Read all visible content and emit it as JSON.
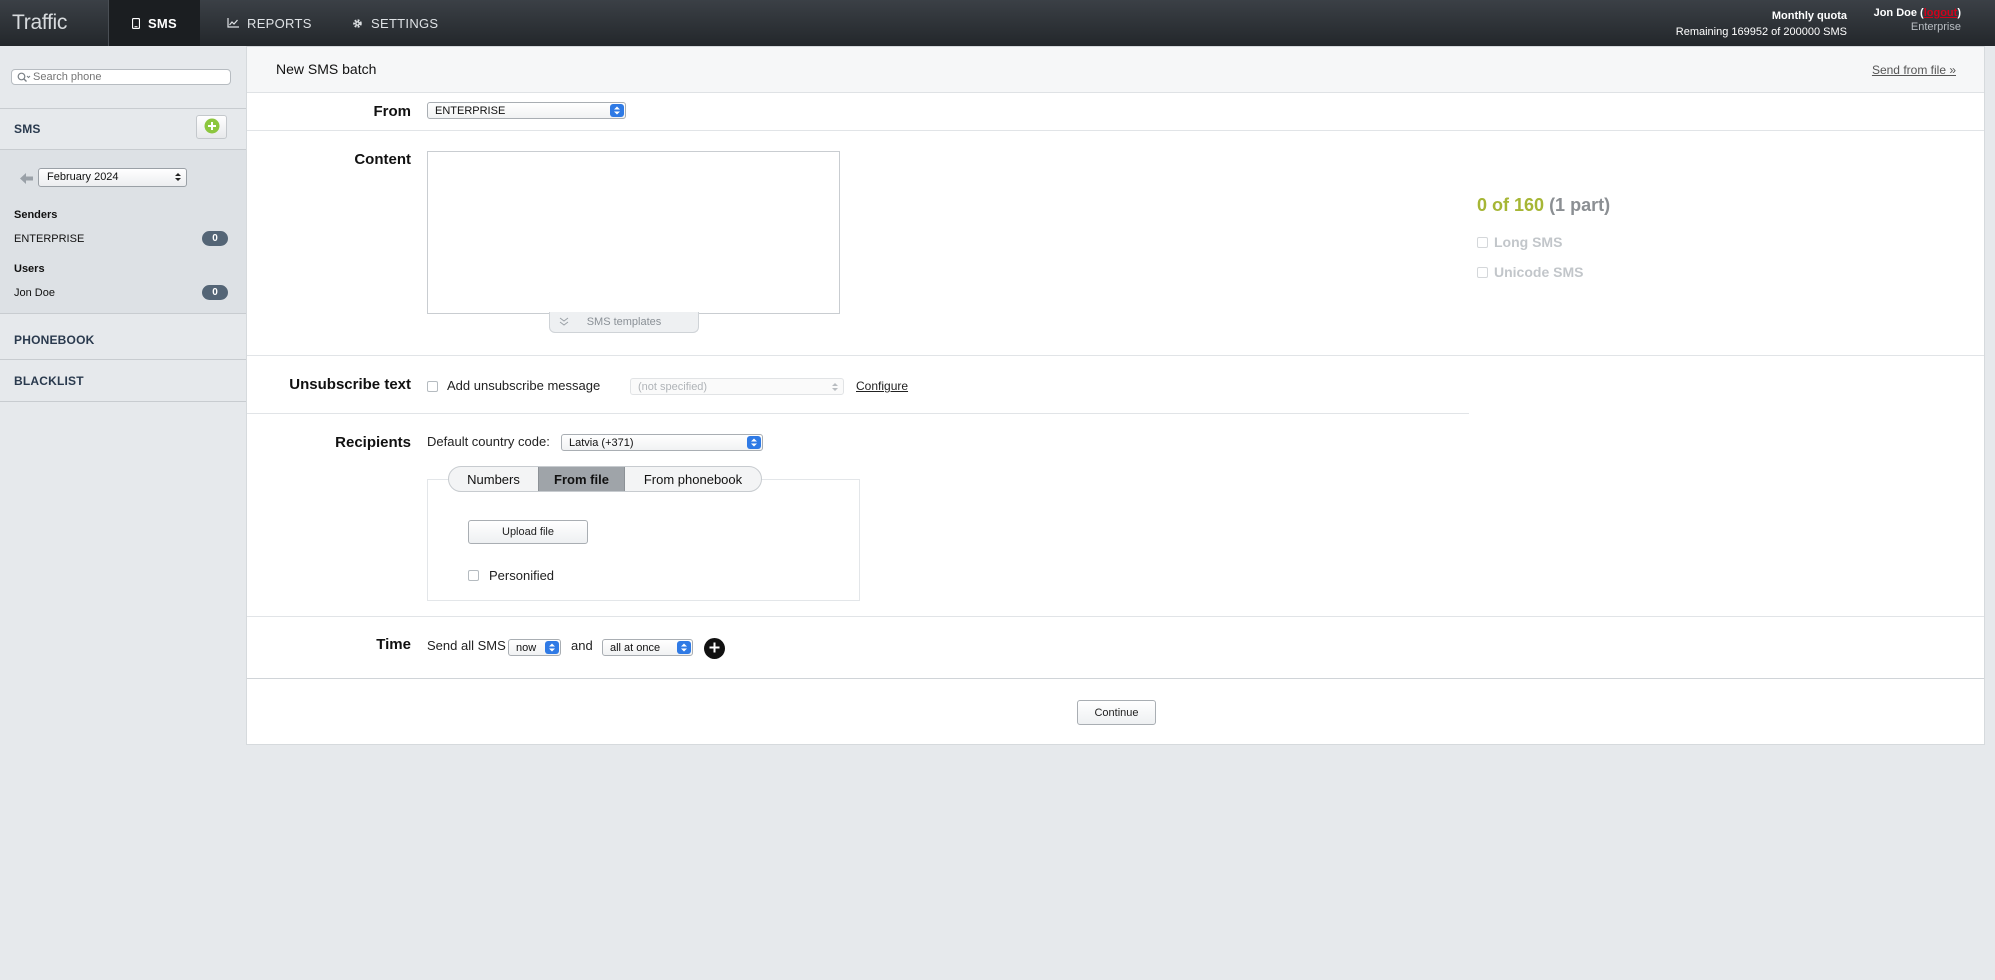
{
  "topbar": {
    "brand": "Traffic",
    "nav": [
      {
        "label": "SMS",
        "icon": "phone-icon"
      },
      {
        "label": "REPORTS",
        "icon": "chart-icon"
      },
      {
        "label": "SETTINGS",
        "icon": "gear-icon"
      }
    ],
    "quota_title": "Monthly quota",
    "quota_remaining": "Remaining 169952 of 200000 SMS",
    "user_name": "Jon Doe",
    "logout": "logout",
    "org": "Enterprise"
  },
  "sidebar": {
    "search_placeholder": "Search phone",
    "sms_heading": "SMS",
    "month": "February 2024",
    "senders_heading": "Senders",
    "senders": [
      {
        "name": "ENTERPRISE",
        "count": "0"
      }
    ],
    "users_heading": "Users",
    "users": [
      {
        "name": "Jon Doe",
        "count": "0"
      }
    ],
    "phonebook": "PHONEBOOK",
    "blacklist": "BLACKLIST"
  },
  "main": {
    "title": "New SMS batch",
    "send_from_file": "Send from file »",
    "from_label": "From",
    "from_value": "ENTERPRISE",
    "content_label": "Content",
    "templates_tab": "SMS templates",
    "counter_main": "0 of 160",
    "counter_part": "(1 part)",
    "long_sms": "Long SMS",
    "unicode_sms": "Unicode SMS",
    "unsub_label": "Unsubscribe text",
    "unsub_checkbox": "Add unsubscribe message",
    "unsub_select": "(not specified)",
    "configure": "Configure",
    "recipients_label": "Recipients",
    "country_label": "Default country code:",
    "country_value": "Latvia (+371)",
    "tabs": {
      "numbers": "Numbers",
      "from_file": "From file",
      "from_phonebook": "From phonebook"
    },
    "upload": "Upload file",
    "personified": "Personified",
    "time_label": "Time",
    "send_all": "Send all SMS",
    "when_value": "now",
    "and": "and",
    "how_value": "all at once",
    "continue": "Continue"
  },
  "colors": {
    "counter_green": "#a6b635",
    "badge": "#546576",
    "select_blue": "#2f7ae5"
  }
}
